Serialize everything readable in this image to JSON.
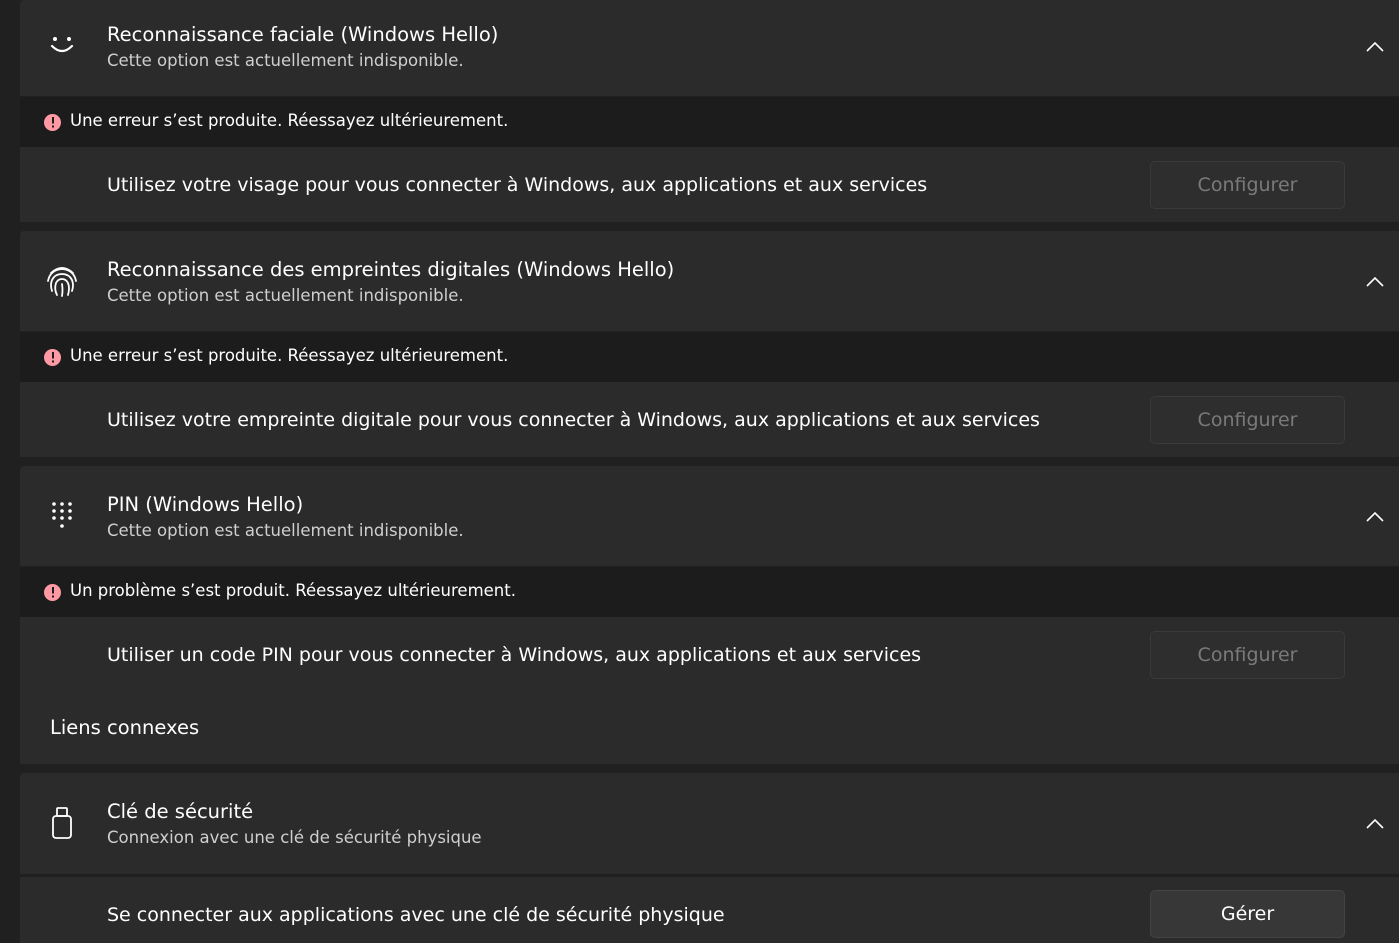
{
  "sections": [
    {
      "icon": "face-smile-icon",
      "title": "Reconnaissance faciale (Windows Hello)",
      "subtitle": "Cette option est actuellement indisponible.",
      "error": "Une erreur s’est produite. Réessayez ultérieurement.",
      "row_text": "Utilisez votre visage pour vous connecter à Windows, aux applications et aux services",
      "button": "Configurer",
      "button_enabled": false
    },
    {
      "icon": "fingerprint-icon",
      "title": "Reconnaissance des empreintes digitales (Windows Hello)",
      "subtitle": "Cette option est actuellement indisponible.",
      "error": "Une erreur s’est produite. Réessayez ultérieurement.",
      "row_text": "Utilisez votre empreinte digitale pour vous connecter à Windows, aux applications et aux services",
      "button": "Configurer",
      "button_enabled": false
    },
    {
      "icon": "pin-keypad-icon",
      "title": "PIN (Windows Hello)",
      "subtitle": "Cette option est actuellement indisponible.",
      "error": "Un problème s’est produit. Réessayez ultérieurement.",
      "row_text": "Utiliser un code PIN pour vous connecter à Windows, aux applications et aux services",
      "button": "Configurer",
      "button_enabled": false
    }
  ],
  "related": {
    "label": "Liens connexes"
  },
  "security_key": {
    "icon": "usb-key-icon",
    "title": "Clé de sécurité",
    "subtitle": "Connexion avec une clé de sécurité physique",
    "row_text": "Se connecter aux applications avec une clé de sécurité physique",
    "button": "Gérer",
    "button_enabled": true
  },
  "colors": {
    "background": "#202020",
    "card": "#2b2b2b",
    "error_strip": "#1c1c1c",
    "error_icon": "#ff99a4"
  }
}
